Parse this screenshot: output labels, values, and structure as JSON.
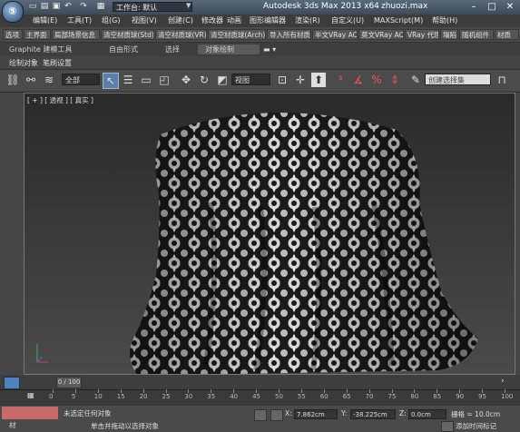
{
  "titlebar": {
    "workspace_label": "工作台: 默认",
    "app_title": "Autodesk 3ds Max  2013 x64",
    "file_name": "zhuozi.max"
  },
  "menu": [
    "编辑(E)",
    "工具(T)",
    "组(G)",
    "视图(V)",
    "创建(C)",
    "修改器",
    "动画",
    "图形编辑器",
    "渲染(R)",
    "自定义(U)",
    "MAXScript(M)",
    "帮助(H)"
  ],
  "quad_toolbar": [
    "选项",
    "主界面",
    "局部场景信息",
    "清空材质球(Std)",
    "清空材质球(VR)",
    "清空材质球(Arch)",
    "导入所有材质",
    "半文VRay AO",
    "莫文VRay AO",
    "VRay 代理",
    "塌陷",
    "随机组件",
    "材质"
  ],
  "ribbon": {
    "tabs": [
      "Graphite 建模工具",
      "自由形式",
      "选择",
      "对象绘制"
    ],
    "sub": [
      "绘制对象",
      "笔刷设置"
    ]
  },
  "main_toolbar": {
    "filter_value": "全部",
    "view_value": "视图",
    "selection_set_placeholder": "创建选择集"
  },
  "viewport": {
    "label": "[ + ] [ 透视 ] [ 真实 ]"
  },
  "timeline": {
    "frame_readout": "0 / 100",
    "ticks": [
      "0",
      "5",
      "10",
      "15",
      "20",
      "25",
      "30",
      "35",
      "40",
      "45",
      "50",
      "55",
      "60",
      "65",
      "70",
      "75",
      "80",
      "85",
      "90",
      "95",
      "100"
    ]
  },
  "status": {
    "selection_text": "未选定任何对象",
    "prompt_text": "单击并拖动以选择对象",
    "x_label": "X:",
    "x_value": "7.862cm",
    "y_label": "Y:",
    "y_value": "-38.225cm",
    "z_label": "Z:",
    "z_value": "0.0cm",
    "grid_text": "栅格 = 10.0cm",
    "add_time_tag": "添加时间标记",
    "left_tab_label": "材"
  }
}
